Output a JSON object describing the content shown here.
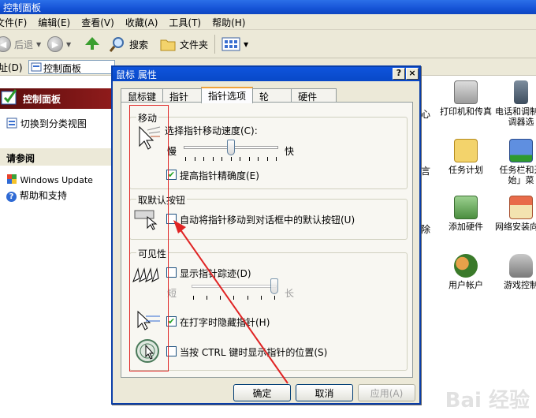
{
  "window": {
    "title": "控制面板",
    "menu": [
      "文件(F)",
      "编辑(E)",
      "查看(V)",
      "收藏(A)",
      "工具(T)",
      "帮助(H)"
    ],
    "toolbar": {
      "back": "后退",
      "search": "搜索",
      "folders": "文件夹"
    },
    "address_label": "地址(D)",
    "address_value": "控制面板"
  },
  "left_pane": {
    "header": "控制面板",
    "switch_view": "切换到分类视图",
    "see_also_title": "请参阅",
    "links": [
      "Windows Update",
      "帮助和支持"
    ]
  },
  "right_pane": {
    "items": [
      "打印机和传真",
      "电话和调制解调器选",
      "任务计划",
      "任务栏和开始」菜",
      "添加硬件",
      "网络安装向导",
      "用户帐户",
      "游戏控制"
    ],
    "partial_labels": [
      "心",
      "言",
      "除"
    ]
  },
  "dialog": {
    "title": "鼠标 属性",
    "help_btn": "?",
    "close_btn": "×",
    "tabs": [
      "鼠标键",
      "指针",
      "指针选项",
      "轮",
      "硬件"
    ],
    "active_tab": "指针选项",
    "motion": {
      "title": "移动",
      "speed_label": "选择指针移动速度(C):",
      "slow": "慢",
      "fast": "快",
      "speed_value": 0.5,
      "precision_label": "提高指针精确度(E)",
      "precision_checked": true
    },
    "snap": {
      "title": "取默认按钮",
      "label": "自动将指针移动到对话框中的默认按钮(U)",
      "checked": false
    },
    "visibility": {
      "title": "可见性",
      "trails_label": "显示指针踪迹(D)",
      "trails_checked": false,
      "short": "短",
      "long": "长",
      "trails_value": 1.0,
      "hide_label": "在打字时隐藏指针(H)",
      "hide_checked": true,
      "ctrl_label": "当按 CTRL 键时显示指针的位置(S)",
      "ctrl_checked": false
    },
    "buttons": {
      "ok": "确定",
      "cancel": "取消",
      "apply": "应用(A)"
    },
    "check_mark": "✔"
  },
  "annotation_colors": {
    "box": "#e02424",
    "arrow": "#e02424"
  },
  "watermark": "Bai 经验"
}
